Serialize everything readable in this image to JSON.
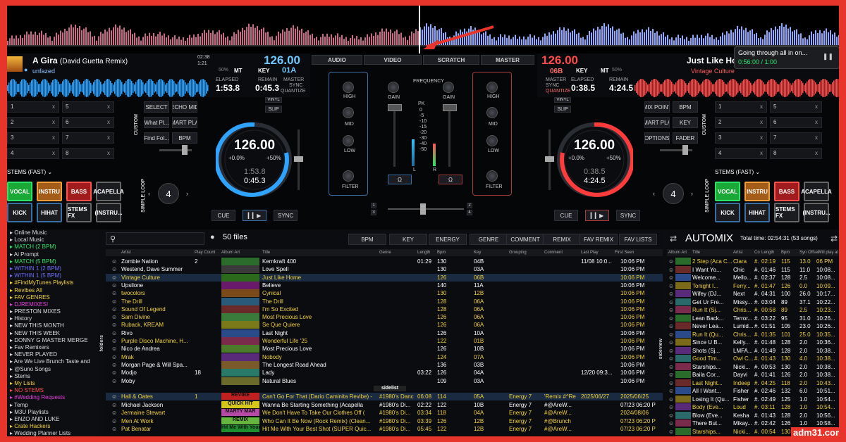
{
  "deck_left": {
    "title": "A Gira",
    "title_extra": "(David Guetta Remix)",
    "artist": "unfazed",
    "time_a": "02:38",
    "time_b": "1:21",
    "bpm": "126.00",
    "pitch": "50%",
    "key_label": "KEY",
    "key": "01A",
    "elapsed_label": "ELAPSED",
    "elapsed": "1:53.8",
    "remain_label": "REMAIN",
    "remain": "0:45.3",
    "jog_bpm": "126.00",
    "jog_pitch_l": "+0.0%",
    "jog_pitch_r": "+50%",
    "jog_elapsed": "1:53.8",
    "jog_remain": "0:45.3",
    "cue": "CUE",
    "sync": "SYNC",
    "loop": "4",
    "stems": "STEMS (FAST)",
    "pads": [
      "VOCAL",
      "INSTRU",
      "BASS",
      "ACAPELLA",
      "KICK",
      "HIHAT",
      "STEMS FX",
      "(INSTRU..."
    ],
    "slots": [
      "1",
      "2",
      "3",
      "4",
      "5",
      "6",
      "7",
      "8"
    ],
    "custom": [
      "SELECT",
      "ECHO MID",
      "What Pl...",
      "MART PLA",
      "Find Fol...",
      "BPM"
    ],
    "vinyl": "VINYL",
    "slip": "SLIP",
    "custom_label": "CUSTOM",
    "simple_loop": "SIMPLE LOOP",
    "mt": "MT",
    "master": "MASTER",
    "sync_lbl": "SYNC",
    "quantize": "QUANTIZE"
  },
  "deck_right": {
    "title": "Just Like Home",
    "artist": "Vintage Culture",
    "bpm": "126.00",
    "key_label": "KEY",
    "key": "06B",
    "pitch": "50%",
    "elapsed_label": "ELAPSED",
    "elapsed": "0:38.5",
    "remain_label": "REMAIN",
    "remain": "4:24.5",
    "jog_bpm": "126.00",
    "jog_pitch_l": "+0.0%",
    "jog_pitch_r": "+50%",
    "jog_elapsed": "0:38.5",
    "jog_remain": "4:24.5",
    "cue": "CUE",
    "sync": "SYNC",
    "loop": "4",
    "stems": "STEMS (FAST)",
    "pads": [
      "VOCAL",
      "INSTRU",
      "BASS",
      "ACAPELLA",
      "KICK",
      "HIHAT",
      "STEMS FX",
      "(INSTRU..."
    ],
    "slots": [
      "1",
      "2",
      "3",
      "4",
      "5",
      "6",
      "7",
      "8"
    ],
    "custom": [
      "MIX POINT",
      "BPM",
      "MART PLA",
      "KEY",
      "OPTIONS",
      "FADER"
    ],
    "vinyl": "VINYL",
    "slip": "SLIP",
    "custom_label": "CUSTOM",
    "simple_loop": "SIMPLE LOOP",
    "mt": "MT",
    "master": "MASTER",
    "sync_lbl": "SYNC",
    "quantize": "QUANTIZE"
  },
  "mixer": {
    "tabs": [
      "AUDIO",
      "VIDEO",
      "SCRATCH",
      "MASTER"
    ],
    "filter": "FREQUENCY",
    "high": "HIGH",
    "mid": "MID",
    "low": "LOW",
    "filter_lbl": "FILTER",
    "gain": "GAIN",
    "pk": "PK",
    "meter": [
      "0",
      "-5",
      "-10",
      "-15",
      "-20",
      "-30",
      "-40",
      "-50"
    ],
    "lr": [
      "L",
      "R"
    ],
    "xfade": [
      "1",
      "2",
      "3",
      "4"
    ]
  },
  "notification": {
    "text": "Going through all in on...",
    "time": "0:56:00 / 1:00"
  },
  "browser": {
    "files_count": "50 files",
    "search_placeholder": "",
    "header_buttons": [
      "BPM",
      "KEY",
      "ENERGY",
      "GENRE",
      "COMMENT",
      "REMIX",
      "FAV REMIX",
      "FAV LISTS"
    ],
    "columns": [
      "Artist",
      "Play Count",
      "Album Art",
      "Title",
      "Genre",
      "Length",
      "Bpm",
      "Key",
      "Grouping",
      "Comment",
      "Last Play",
      "First Seen"
    ],
    "sidelist": "sidelist",
    "folders_tab": "folders",
    "sideview_tab": "sideview",
    "rows": [
      [
        "Zombie Nation",
        "2",
        "",
        "Kernkraft 400",
        "",
        "01:29",
        "130",
        "04B",
        "",
        "",
        "11/08 10:0...",
        "10:06 PM"
      ],
      [
        "Westend, Dave Summer",
        "",
        "",
        "Love Spell",
        "",
        "",
        "130",
        "03A",
        "",
        "",
        "",
        "10:06 PM"
      ],
      [
        "Vintage Culture",
        "",
        "",
        "Just Like Home",
        "",
        "",
        "126",
        "06B",
        "",
        "",
        "",
        "10:06 PM"
      ],
      [
        "Upsilone",
        "",
        "",
        "Believe",
        "",
        "",
        "140",
        "11A",
        "",
        "",
        "",
        "10:06 PM"
      ],
      [
        "twocolors",
        "",
        "",
        "Cynical",
        "",
        "",
        "130",
        "12B",
        "",
        "",
        "",
        "10:06 PM"
      ],
      [
        "The Drill",
        "",
        "",
        "The Drill",
        "",
        "",
        "128",
        "06A",
        "",
        "",
        "",
        "10:06 PM"
      ],
      [
        "Sound Of Legend",
        "",
        "",
        "I'm So Excited",
        "",
        "",
        "128",
        "06A",
        "",
        "",
        "",
        "10:06 PM"
      ],
      [
        "Sam Divine",
        "",
        "",
        "Most Precious Love",
        "",
        "",
        "126",
        "06A",
        "",
        "",
        "",
        "10:06 PM"
      ],
      [
        "Ruback, KREAM",
        "",
        "",
        "Se Que Quiere",
        "",
        "",
        "126",
        "06A",
        "",
        "",
        "",
        "10:06 PM"
      ],
      [
        "Rivo",
        "",
        "",
        "Last Night",
        "",
        "",
        "126",
        "10A",
        "",
        "",
        "",
        "10:06 PM"
      ],
      [
        "Purple Disco Machine, H...",
        "",
        "",
        "Wonderful Life '25",
        "",
        "",
        "122",
        "01B",
        "",
        "",
        "",
        "10:06 PM"
      ],
      [
        "Nico de Andrea",
        "",
        "",
        "Most Precious Love",
        "",
        "",
        "126",
        "10B",
        "",
        "",
        "",
        "10:06 PM"
      ],
      [
        "Mrak",
        "",
        "",
        "Nobody",
        "",
        "",
        "124",
        "07A",
        "",
        "",
        "",
        "10:06 PM"
      ],
      [
        "Morgan Page & Will Spa...",
        "",
        "",
        "The Longest Road Ahead",
        "",
        "",
        "136",
        "03B",
        "",
        "",
        "",
        "10:06 PM"
      ],
      [
        "Modjo",
        "18",
        "",
        "Lady",
        "",
        "03:22",
        "126",
        "04A",
        "",
        "",
        "12/20 09:3...",
        "10:06 PM"
      ],
      [
        "Moby",
        "",
        "",
        "Natural Blues",
        "",
        "",
        "109",
        "03A",
        "",
        "",
        "",
        "10:06 PM"
      ]
    ],
    "rows2": [
      [
        "Hall & Oates",
        "1",
        "REVIBE",
        "Can't Go For That (Dario Caminita Revibe) -",
        "#1980's Danc",
        "06:08",
        "114",
        "05A",
        "Energy 7",
        "'Remix #^Re",
        "2025/06/27",
        "2025/06/25"
      ],
      [
        "Michael Jackson",
        "",
        "QUICK HIT",
        "Wanna Be Starting Something (Acapella",
        "#1980's Di...",
        "02:22",
        "122",
        "10B",
        "Energy 7",
        "#@AreW...",
        "",
        "07/23 06:20 PM"
      ],
      [
        "Jermaine Stewart",
        "",
        "MARTY MAR",
        "We Don't Have To Take Our Clothes Off (",
        "#1980's Di...",
        "03:34",
        "118",
        "04A",
        "Energy 7",
        "#@AreW...",
        "",
        "2024/08/06"
      ],
      [
        "Men At Work",
        "",
        "REMIX",
        "Who Can It Be Now (Rock Remix) (Clean...",
        "#1980's Di...",
        "03:39",
        "126",
        "12B",
        "Energy 7",
        "#@Brunch",
        "",
        "07/23 06:20 PM"
      ],
      [
        "Pat Benatar",
        "",
        "Hit Me With Your",
        "Hit Me With Your Best Shot (SUPER Quic...",
        "#1980's Di...",
        "05:45",
        "122",
        "12B",
        "Energy 7",
        "#@AreW...",
        "",
        "07/23 06:20 PM"
      ]
    ]
  },
  "tree": [
    {
      "t": "Online Music",
      "c": ""
    },
    {
      "t": "Local Music",
      "c": ""
    },
    {
      "t": "MATCH (2 BPM)",
      "c": "g"
    },
    {
      "t": "Ai Prompt",
      "c": ""
    },
    {
      "t": "MATCH (5 BPM)",
      "c": "g"
    },
    {
      "t": "WITHIN 1 (2 BPM)",
      "c": "b"
    },
    {
      "t": "WITHIN 1 (5 BPM)",
      "c": "b"
    },
    {
      "t": "#FindMyTunes Playlists",
      "c": "y"
    },
    {
      "t": "Revibes All",
      "c": "y"
    },
    {
      "t": "FAV GENRES",
      "c": "y"
    },
    {
      "t": "DJREMIXES!",
      "c": "p"
    },
    {
      "t": "PRESTON MIXES",
      "c": ""
    },
    {
      "t": "History",
      "c": ""
    },
    {
      "t": "NEW THIS MONTH",
      "c": ""
    },
    {
      "t": "NEW THIS WEEK",
      "c": ""
    },
    {
      "t": "DONNY G MASTER MERGE",
      "c": ""
    },
    {
      "t": "Fav Remixers",
      "c": ""
    },
    {
      "t": "NEVER PLAYED",
      "c": ""
    },
    {
      "t": "Are We Live Brunch Taste and",
      "c": ""
    },
    {
      "t": "@Suno Songs",
      "c": ""
    },
    {
      "t": "Stems",
      "c": ""
    },
    {
      "t": "My Lists",
      "c": "y"
    },
    {
      "t": "NO STEMS",
      "c": "r"
    },
    {
      "t": "#Wedding Requests",
      "c": "p"
    },
    {
      "t": "Temp",
      "c": ""
    },
    {
      "t": "M3U Playlists",
      "c": ""
    },
    {
      "t": "ENZO AND LUKE",
      "c": ""
    },
    {
      "t": "Crate Hackers",
      "c": "y"
    },
    {
      "t": "Wedding Planner Lists",
      "c": ""
    }
  ],
  "automix": {
    "title": "AUTOMIX",
    "total": "Total time: 02:54:31 (53 songs)",
    "columns": [
      "Album Art",
      "Title",
      "Artist",
      "Co",
      "Length",
      "Bpm",
      "Syn Offset",
      "Will play at"
    ],
    "rows": [
      [
        "2 Step (Aca C...",
        "Clara",
        "#.",
        "02:19",
        "115",
        "13.0",
        "06 PM"
      ],
      [
        "I Want Yo...",
        "Chic",
        "#.",
        "01:46",
        "115",
        "11.0",
        "10:08..."
      ],
      [
        "Welcome...",
        "Mello...",
        "#.",
        "02:37",
        "128",
        "2.5",
        "10:08..."
      ],
      [
        "Tonight I...",
        "Ferry...",
        "#.",
        "01:47",
        "126",
        "0.0",
        "10:09..."
      ],
      [
        "Wifey (DJ...",
        "Next",
        "#.",
        "04:31",
        "100",
        "26.0",
        "10:17..."
      ],
      [
        "Get Ur Fre...",
        "Missy...",
        "#.",
        "03:04",
        "89",
        "37.1",
        "10:22..."
      ],
      [
        "Run It (Sj...",
        "Chris...",
        "#.",
        "00:58",
        "89",
        "2.5",
        "10:23..."
      ],
      [
        "Lean Back...",
        "Terror...",
        "#.",
        "03:22",
        "95",
        "31.0",
        "10:26..."
      ],
      [
        "Never Lea...",
        "Lumid...",
        "#.",
        "01:51",
        "105",
        "23.0",
        "10:26..."
      ],
      [
        "Run It (Qu...",
        "Chris...",
        "#.",
        "01:35",
        "101",
        "25.0",
        "10:35..."
      ],
      [
        "Since U B...",
        "Kelly...",
        "#.",
        "01:48",
        "128",
        "2.0",
        "10:36..."
      ],
      [
        "Shots (Sj...",
        "LMFA...",
        "#.",
        "01:49",
        "128",
        "2.0",
        "10:38..."
      ],
      [
        "Good Tim...",
        "Owl C...",
        "#.",
        "01:43",
        "130",
        "4.0",
        "10:38..."
      ],
      [
        "Starships...",
        "Nicki...",
        "#.",
        "00:53",
        "130",
        "2.0",
        "10:38..."
      ],
      [
        "Baila Cor...",
        "Dayvi",
        "#.",
        "01:41",
        "126",
        "2.0",
        "10:38..."
      ],
      [
        "Last Night...",
        "Indeep",
        "#.",
        "04:25",
        "118",
        "2.0",
        "10:43..."
      ],
      [
        "All I Want...",
        "Fisher",
        "#.",
        "02:46",
        "132",
        "6.0",
        "10:51..."
      ],
      [
        "Losing It (Qu...",
        "Fisher",
        "#.",
        "02:49",
        "125",
        "1.0",
        "10:54..."
      ],
      [
        "Body (Eve...",
        "Loud",
        "#.",
        "03:11",
        "128",
        "1.0",
        "10:54..."
      ],
      [
        "Blow (Eve...",
        "Kesha",
        "#.",
        "01:43",
        "128",
        "2.0",
        "10:56..."
      ],
      [
        "There But...",
        "Mikay...",
        "#.",
        "02:42",
        "126",
        "1.0",
        "10:58..."
      ],
      [
        "Starships...",
        "Nicki...",
        "#.",
        "00:54",
        "130",
        "1.0",
        "10:58..."
      ],
      [
        "Red Lights...",
        "Tiesto",
        "#.",
        "01:30",
        "130",
        "1.0",
        "11:00..."
      ]
    ]
  },
  "colors": {
    "blue": "#2ea3ff",
    "red": "#ff3b3b",
    "green": "#2ee36a",
    "yellow": "#f2d23a"
  },
  "watermark": "adm31.com"
}
